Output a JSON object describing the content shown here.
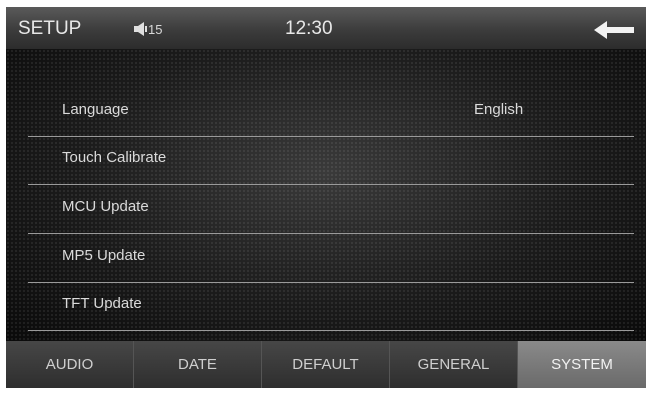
{
  "header": {
    "title": "SETUP",
    "volume": "15",
    "clock": "12:30",
    "back_icon": "back-arrow-icon",
    "volume_icon": "speaker-icon"
  },
  "menu": {
    "items": [
      {
        "label": "Language",
        "value": "English"
      },
      {
        "label": "Touch Calibrate",
        "value": ""
      },
      {
        "label": "MCU Update",
        "value": ""
      },
      {
        "label": "MP5 Update",
        "value": ""
      },
      {
        "label": "TFT Update",
        "value": ""
      }
    ]
  },
  "tabs": [
    {
      "label": "AUDIO",
      "active": false
    },
    {
      "label": "DATE",
      "active": false
    },
    {
      "label": "DEFAULT",
      "active": false
    },
    {
      "label": "GENERAL",
      "active": false
    },
    {
      "label": "SYSTEM",
      "active": true
    }
  ],
  "colors": {
    "bar": "#3c3c3c",
    "active_tab": "#7a7a7a",
    "text": "#dadada"
  }
}
